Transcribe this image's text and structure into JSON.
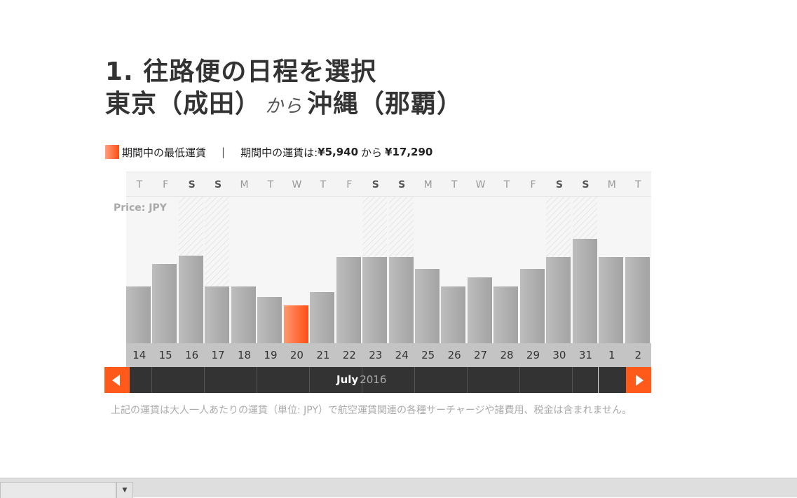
{
  "heading": {
    "line1": "1. 往路便の日程を選択",
    "origin": "東京（成田）",
    "connector": "から",
    "destination": "沖縄（那覇）"
  },
  "legend": {
    "lowest_label": "期間中の最低運賃",
    "separator": "|",
    "range_prefix": "期間中の運賃は:",
    "min_price": "¥5,940",
    "range_connector": "から",
    "max_price": "¥17,290"
  },
  "colors": {
    "accent": "#ff5a1a",
    "bar": "#b0b0b0",
    "month_bar": "#333333"
  },
  "chart": {
    "price_label": "Price: JPY",
    "weekdays": [
      "T",
      "F",
      "S",
      "S",
      "M",
      "T",
      "W",
      "T",
      "F",
      "S",
      "S",
      "M",
      "T",
      "W",
      "T",
      "F",
      "S",
      "S",
      "M",
      "T"
    ],
    "weekend": [
      false,
      false,
      true,
      true,
      false,
      false,
      false,
      false,
      false,
      true,
      true,
      false,
      false,
      false,
      false,
      false,
      true,
      true,
      false,
      false
    ],
    "dates": [
      "14",
      "15",
      "16",
      "17",
      "18",
      "19",
      "20",
      "21",
      "22",
      "23",
      "24",
      "25",
      "26",
      "27",
      "28",
      "29",
      "30",
      "31",
      "1",
      "2"
    ]
  },
  "chart_data": {
    "type": "bar",
    "categories": [
      "14",
      "15",
      "16",
      "17",
      "18",
      "19",
      "20",
      "21",
      "22",
      "23",
      "24",
      "25",
      "26",
      "27",
      "28",
      "29",
      "30",
      "31",
      "1",
      "2"
    ],
    "values": [
      8900,
      12400,
      13800,
      8900,
      8900,
      7300,
      5940,
      8000,
      13500,
      13500,
      13500,
      11700,
      8900,
      10300,
      8900,
      11700,
      13500,
      16400,
      13500,
      13500
    ],
    "highlight_index": 6,
    "ylim": [
      0,
      23000
    ],
    "title": "",
    "xlabel": "",
    "ylabel": "Price: JPY"
  },
  "month_nav": {
    "month": "July",
    "year": "2016",
    "prev_icon": "arrow-left-icon",
    "next_icon": "arrow-right-icon"
  },
  "footnote": "上記の運賃は大人一人あたりの運賃（単位: JPY）で航空運賃関連の各種サーチャージや諸費用、税金は含まれません。",
  "statusbar": {
    "dropdown_icon": "chevron-down-icon",
    "dropdown_glyph": "▼"
  }
}
